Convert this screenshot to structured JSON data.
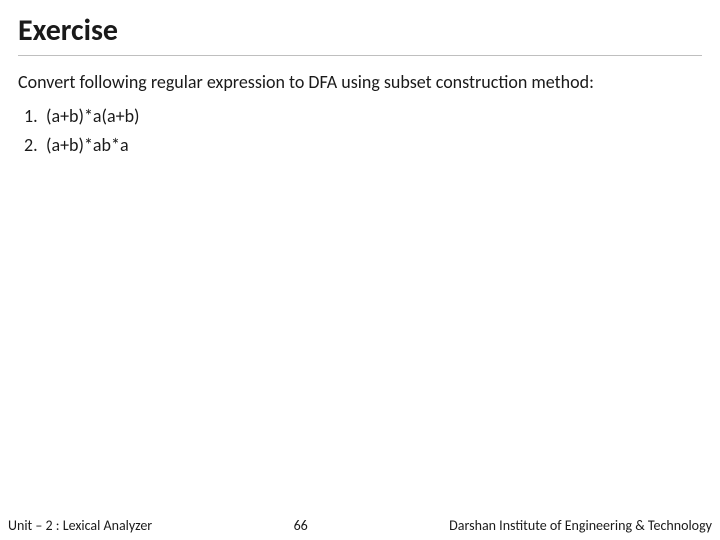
{
  "title": "Exercise",
  "prompt": "Convert following regular expression to DFA using subset construction method:",
  "items": [
    {
      "n": "1.",
      "expr": "(a+b)*a(a+b)"
    },
    {
      "n": "2.",
      "expr": "(a+b)*ab*a"
    }
  ],
  "footer": {
    "unit": "Unit – 2  : Lexical Analyzer",
    "page": "66",
    "org": "Darshan Institute of Engineering & Technology"
  }
}
